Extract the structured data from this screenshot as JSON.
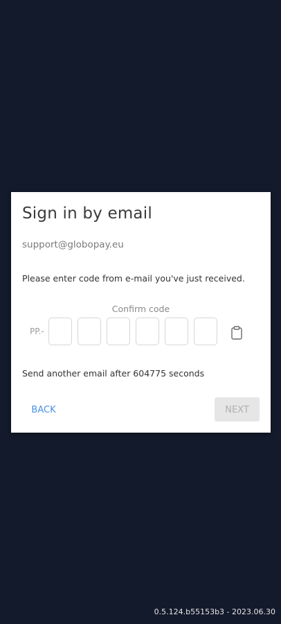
{
  "dialog": {
    "title": "Sign in by email",
    "email": "support@globopay.eu",
    "instruction": "Please enter code from e-mail you've just received.",
    "code_label": "Confirm code",
    "code_prefix": "PP.-",
    "code_digits": [
      "",
      "",
      "",
      "",
      "",
      ""
    ],
    "paste_icon": "clipboard-icon",
    "resend_text": "Send another email after 604775 seconds",
    "back_label": "BACK",
    "next_label": "NEXT"
  },
  "footer": {
    "version": "0.5.124.b55153b3 - 2023.06.30"
  },
  "colors": {
    "background": "#131a2b",
    "dialog": "#ffffff",
    "link": "#4a90e2",
    "disabled_button": "#e6e6e6"
  }
}
